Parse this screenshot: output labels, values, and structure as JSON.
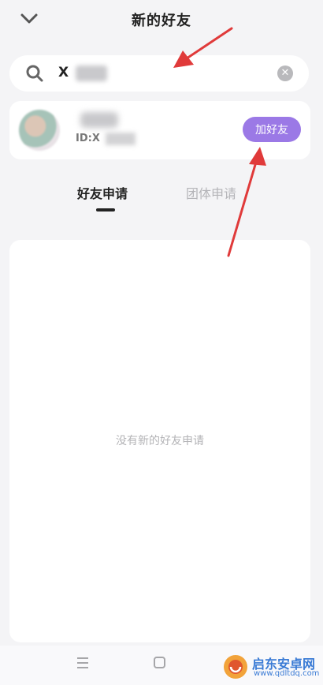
{
  "header": {
    "title": "新的好友",
    "back_icon": "chevron-down-icon"
  },
  "search": {
    "value": "X",
    "clear_icon": "close-icon"
  },
  "result": {
    "id_prefix": "ID:X",
    "add_label": "加好友",
    "accent_color": "#9b79e6"
  },
  "tabs": [
    {
      "label": "好友申请",
      "active": true
    },
    {
      "label": "团体申请",
      "active": false
    }
  ],
  "panel": {
    "empty_text": "没有新的好友申请"
  },
  "nav": {
    "menu_icon": "menu-icon",
    "home_icon": "home-square-icon"
  },
  "watermark": {
    "title": "启东安卓网",
    "url": "www.qdltdq.com"
  },
  "annotation_color": "#e03a3a"
}
